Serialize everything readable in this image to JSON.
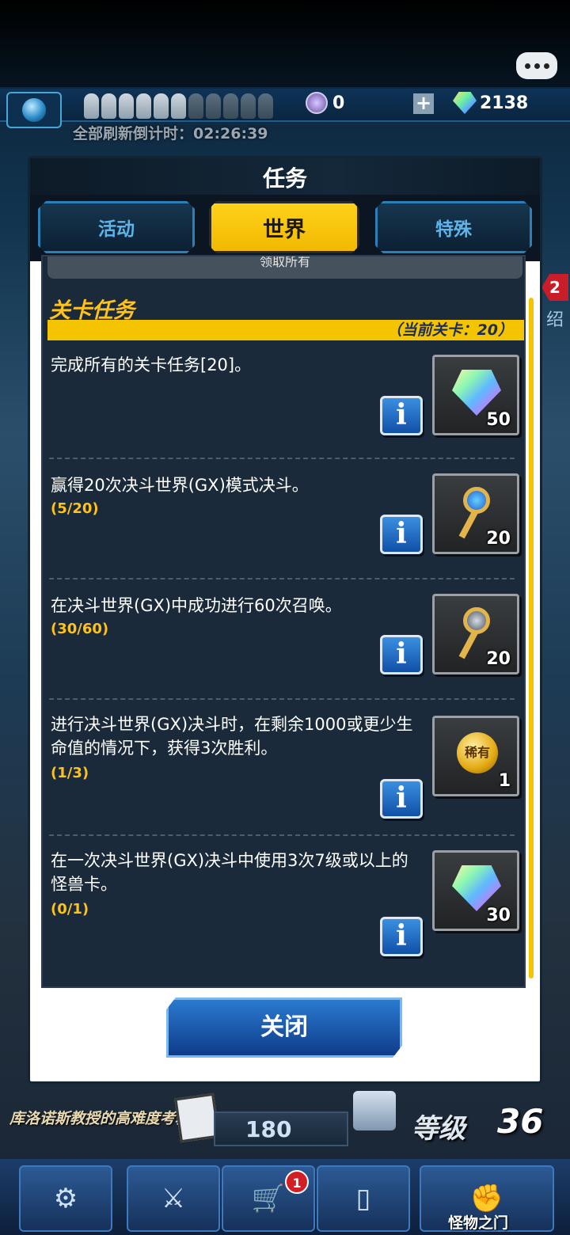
{
  "header": {
    "orb_count": "0",
    "gem_count": "2138",
    "refresh_countdown": "全部刷新倒计时：02:26:39",
    "side_badge": "2",
    "side_text": "绍"
  },
  "modal": {
    "title": "任务",
    "tabs": [
      {
        "label": "活动"
      },
      {
        "label": "世界"
      },
      {
        "label": "特殊"
      }
    ],
    "collect_all": "领取所有",
    "section_title": "关卡任务",
    "current_stage": "（当前关卡：20）",
    "missions": [
      {
        "desc": "完成所有的关卡任务[20]。",
        "progress": "",
        "reward_icon": "gem-icon",
        "reward_qty": "50"
      },
      {
        "desc": "赢得20次决斗世界(GX)模式决斗。",
        "progress": "(5/20)",
        "reward_icon": "blue-key-icon",
        "reward_qty": "20"
      },
      {
        "desc": "在决斗世界(GX)中成功进行60次召唤。",
        "progress": "(30/60)",
        "reward_icon": "silver-key-icon",
        "reward_qty": "20"
      },
      {
        "desc": "进行决斗世界(GX)决斗时，在剩余1000或更少生命值的情况下，获得3次胜利。",
        "progress": "(1/3)",
        "reward_icon": "rare-medal-icon",
        "reward_medal_text": "稀有",
        "reward_qty": "1"
      },
      {
        "desc": "在一次决斗世界(GX)决斗中使用3次7级或以上的怪兽卡。",
        "progress": "(0/1)",
        "reward_icon": "gem-icon",
        "reward_qty": "30"
      }
    ],
    "info_label": "i",
    "close_label": "关闭"
  },
  "bottom": {
    "event_text": "库洛诺斯教授的高难度考验",
    "counter": "180",
    "level_label": "等级",
    "level_value": "36",
    "cart_badge": "1",
    "gate_label": "怪物之门"
  }
}
